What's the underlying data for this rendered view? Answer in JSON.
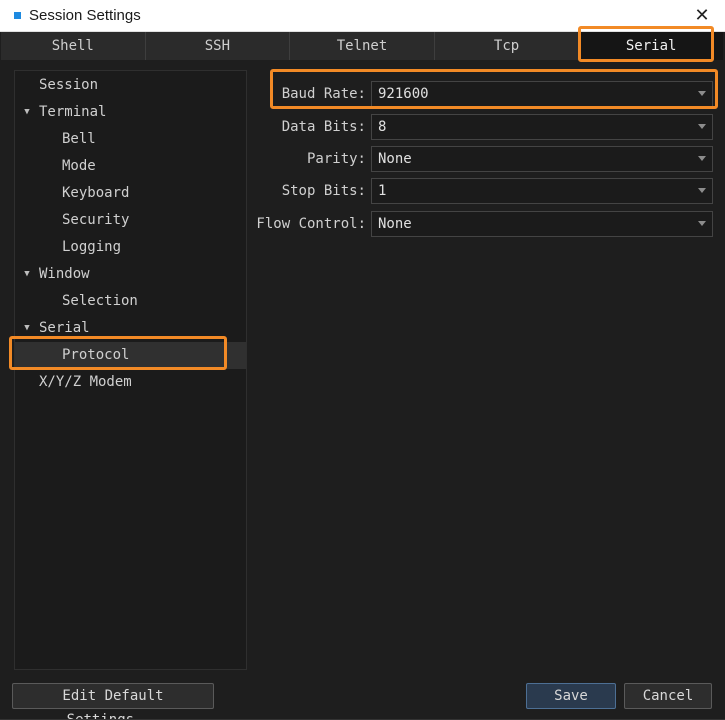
{
  "window": {
    "title": "Session Settings",
    "close_glyph": "✕"
  },
  "tabs": [
    {
      "label": "Shell",
      "mnemonic": "h",
      "active": false
    },
    {
      "label": "SSH",
      "mnemonic": "S",
      "active": false
    },
    {
      "label": "Telnet",
      "mnemonic": "T",
      "active": false
    },
    {
      "label": "Tcp",
      "mnemonic": "c",
      "active": false
    },
    {
      "label": "Serial",
      "mnemonic": "r",
      "active": true
    }
  ],
  "tree": {
    "items": [
      {
        "label": "Session",
        "level": 0,
        "expanded": null,
        "selected": false
      },
      {
        "label": "Terminal",
        "level": 0,
        "expanded": true,
        "selected": false
      },
      {
        "label": "Bell",
        "level": 1,
        "selected": false
      },
      {
        "label": "Mode",
        "level": 1,
        "selected": false
      },
      {
        "label": "Keyboard",
        "level": 1,
        "selected": false
      },
      {
        "label": "Security",
        "level": 1,
        "selected": false
      },
      {
        "label": "Logging",
        "level": 1,
        "selected": false
      },
      {
        "label": "Window",
        "level": 0,
        "expanded": true,
        "selected": false
      },
      {
        "label": "Selection",
        "level": 1,
        "selected": false
      },
      {
        "label": "Serial",
        "level": 0,
        "expanded": true,
        "selected": false
      },
      {
        "label": "Protocol",
        "level": 1,
        "selected": true
      },
      {
        "label": "X/Y/Z Modem",
        "level": 0,
        "expanded": null,
        "selected": false
      }
    ]
  },
  "form": {
    "baud_rate": {
      "label": "Baud Rate:",
      "mnemonic": "B",
      "value": "921600"
    },
    "data_bits": {
      "label": "Data Bits:",
      "mnemonic": "D",
      "value": "8"
    },
    "parity": {
      "label": "Parity:",
      "mnemonic": "P",
      "value": "None"
    },
    "stop_bits": {
      "label": "Stop Bits:",
      "mnemonic": "S",
      "value": "1"
    },
    "flow_control": {
      "label": "Flow Control:",
      "mnemonic": "F",
      "value": "None"
    }
  },
  "buttons": {
    "edit_default": "Edit Default Settings...",
    "save": "Save",
    "cancel": "Cancel"
  },
  "colors": {
    "highlight": "#f28a26",
    "accent_blue": "#1e8ae0",
    "background": "#1e1e1e"
  },
  "icons": {
    "app": "app-square-icon",
    "close": "close-icon",
    "expand": "triangle-down-icon",
    "dropdown": "chevron-down-icon"
  }
}
